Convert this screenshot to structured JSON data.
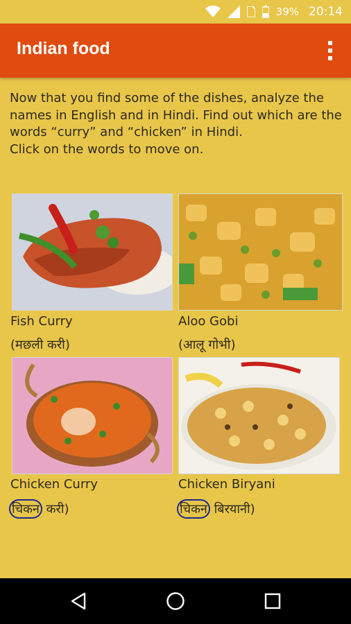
{
  "status_bar": {
    "battery_percent": "39%",
    "time": "20:14",
    "icons": [
      "wifi-icon",
      "signal-icon",
      "sim-icon",
      "battery-icon"
    ]
  },
  "app_bar": {
    "title": "Indian food",
    "menu_icon": "overflow-menu-icon"
  },
  "instructions": {
    "line1": "Now that you find some of the dishes, analyze the names in English and in Hindi. Find out which are the words “curry” and “chicken” in Hindi.",
    "line2": "Click on the words to move on."
  },
  "dishes": [
    {
      "english": "Fish Curry",
      "hindi": "(मछली करी)"
    },
    {
      "english": "Aloo Gobi",
      "hindi": "(आलू गोभी)"
    },
    {
      "english": "Chicken Curry",
      "hindi_open": "(",
      "hindi_word": "चिकन",
      "hindi_rest": " करी)"
    },
    {
      "english": "Chicken Biryani",
      "hindi_open": "(",
      "hindi_word": "चिकन",
      "hindi_rest": " बिरयानी)"
    }
  ],
  "colors": {
    "background": "#e8c64a",
    "app_bar": "#e04b0f",
    "highlight_circle": "#1e2a8c",
    "nav_bar": "#000000"
  },
  "nav_bar": {
    "icons": [
      "back-icon",
      "home-icon",
      "recents-icon"
    ]
  }
}
